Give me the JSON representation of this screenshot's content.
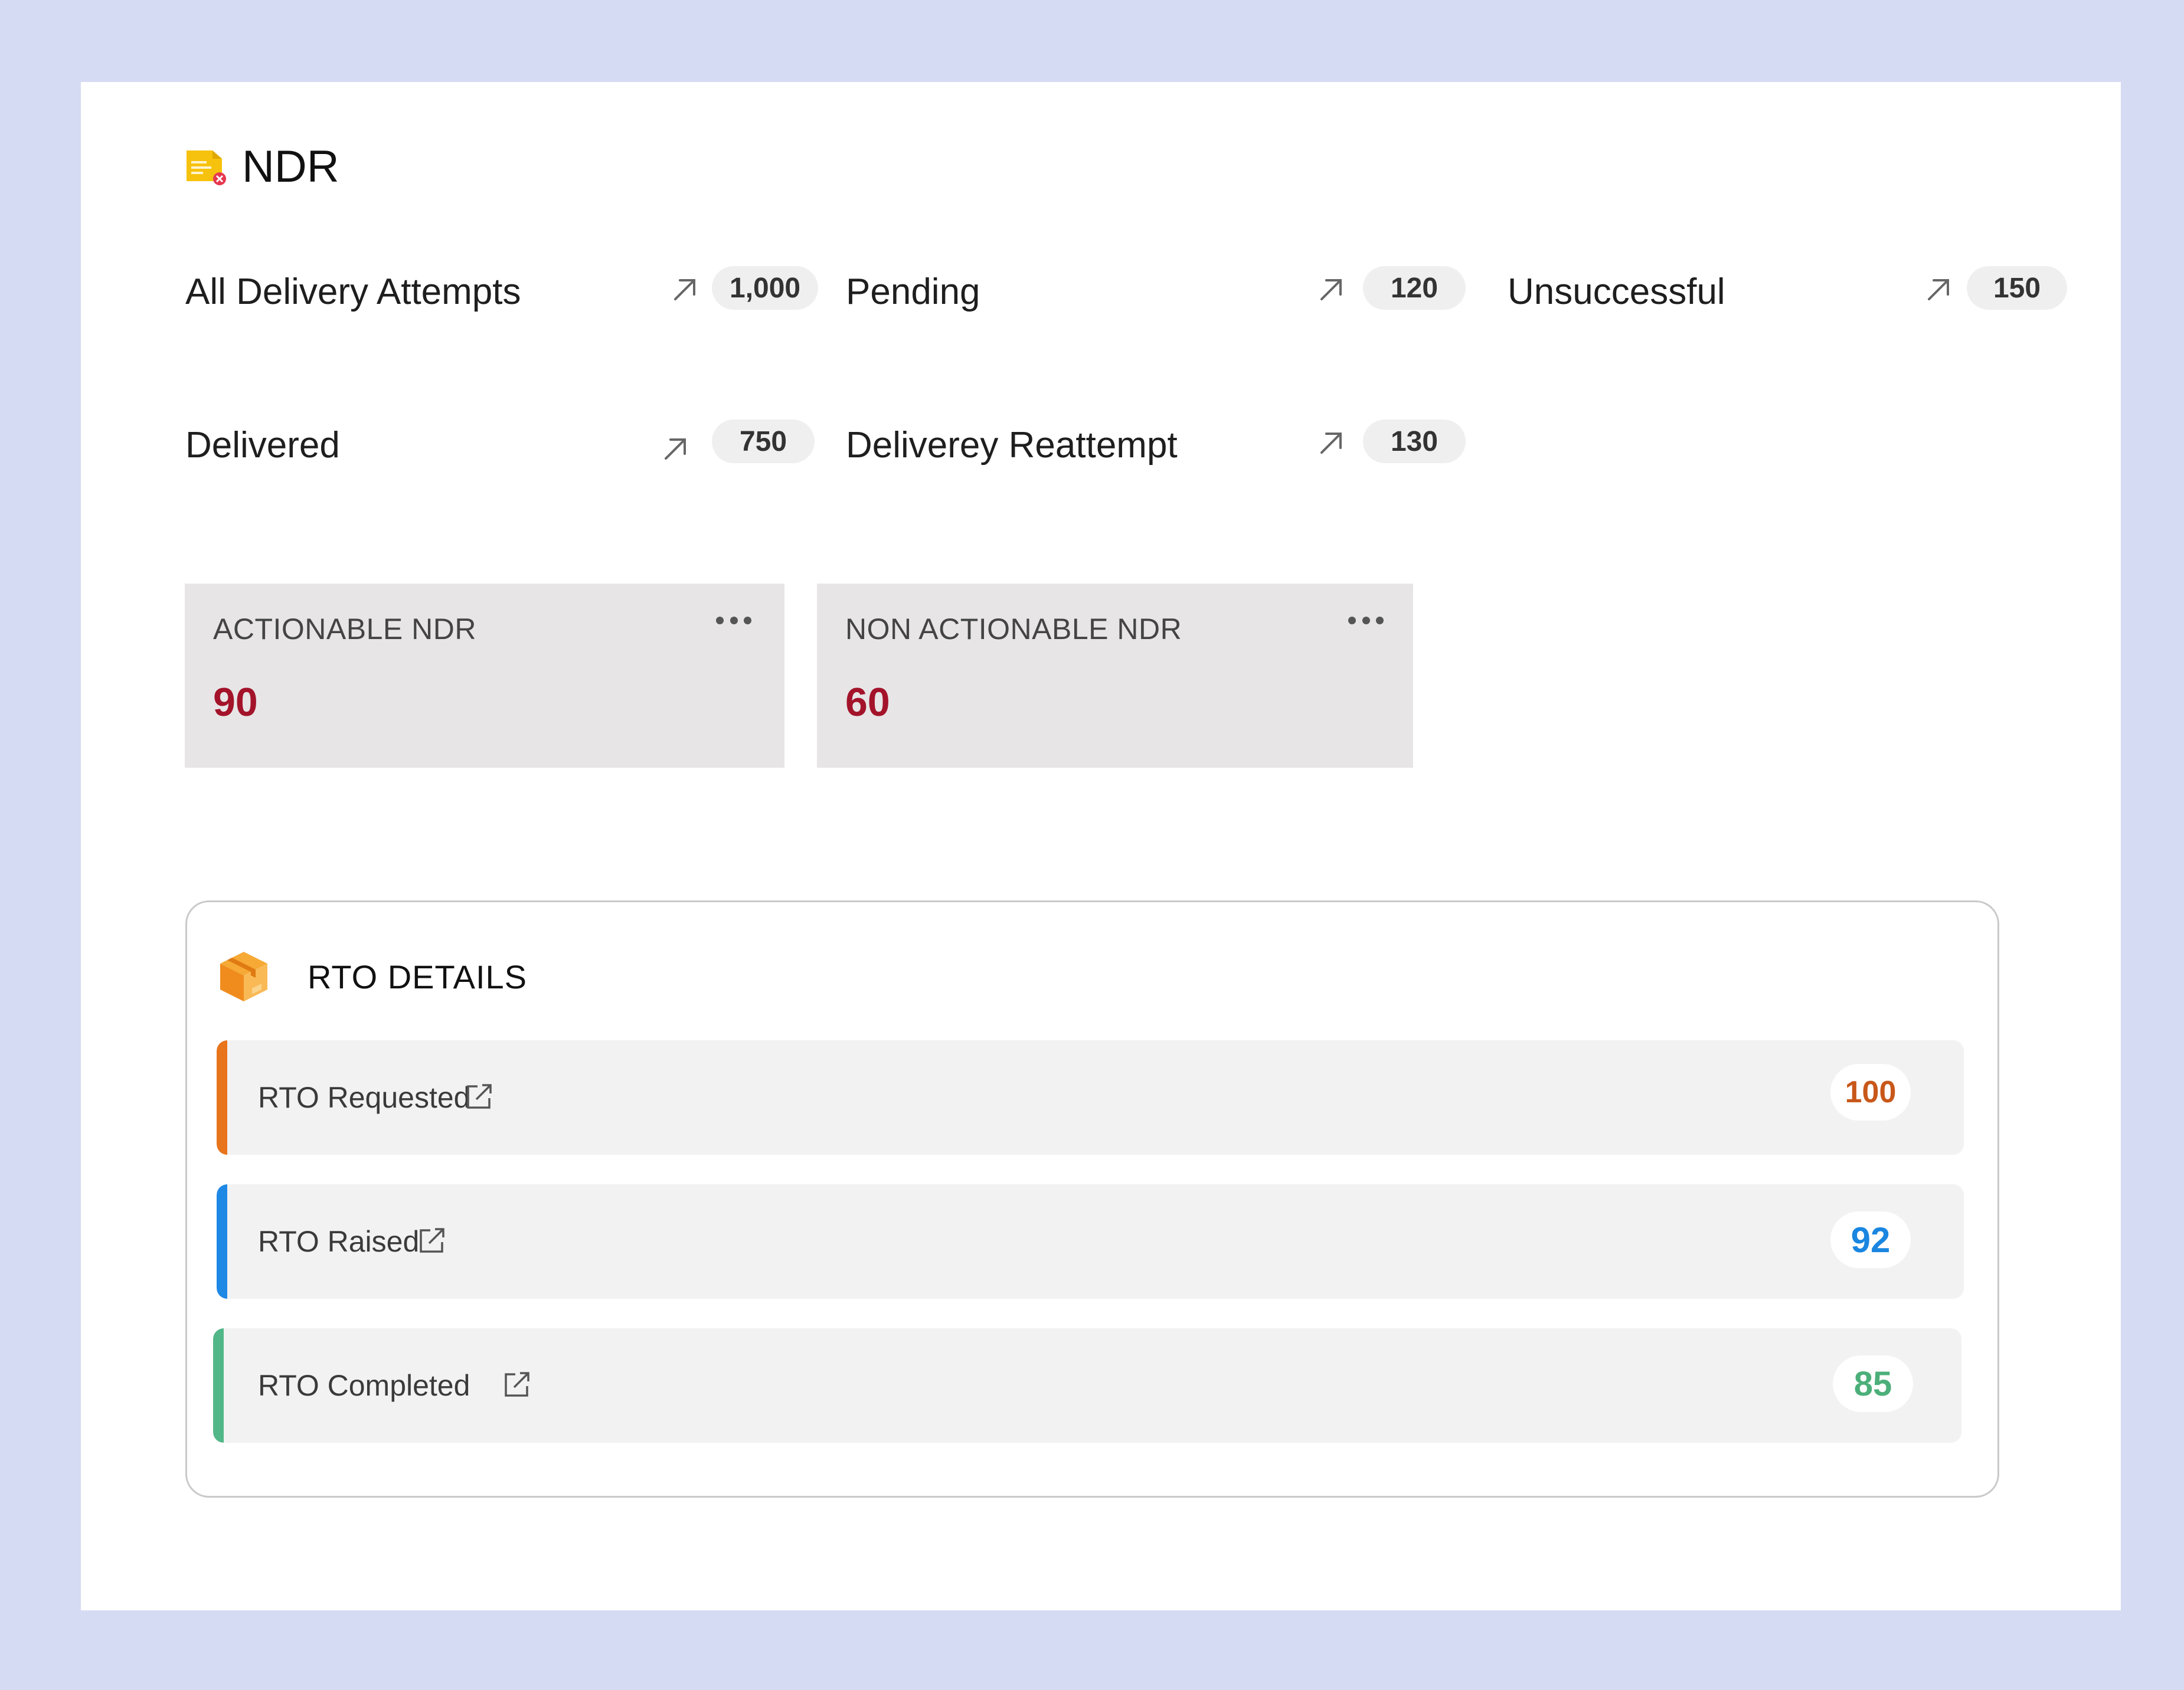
{
  "header": {
    "title": "NDR",
    "icon": "ndr-document-icon"
  },
  "stats": [
    {
      "label": "All Delivery Attempts",
      "value": "1,000"
    },
    {
      "label": "Pending",
      "value": "120"
    },
    {
      "label": "Unsuccessful",
      "value": "150"
    },
    {
      "label": "Delivered",
      "value": "750"
    },
    {
      "label": "Deliverey Reattempt",
      "value": "130"
    }
  ],
  "ndr_cards": [
    {
      "title": "ACTIONABLE NDR",
      "value": "90"
    },
    {
      "title": "NON ACTIONABLE NDR",
      "value": "60"
    }
  ],
  "rto": {
    "title": "RTO DETAILS",
    "icon": "package-box-icon",
    "rows": [
      {
        "label": "RTO Requested",
        "count": "100",
        "color": "#e8741c",
        "count_color": "#c8581a"
      },
      {
        "label": "RTO Raised",
        "count": "92",
        "color": "#1e88e5",
        "count_color": "#1a86e0"
      },
      {
        "label": "RTO Completed",
        "count": "85",
        "color": "#52b788",
        "count_color": "#4caf7a"
      }
    ]
  },
  "colors": {
    "background": "#d6dbf4",
    "card": "#e7e5e6",
    "ndr_value": "#a3132a"
  }
}
